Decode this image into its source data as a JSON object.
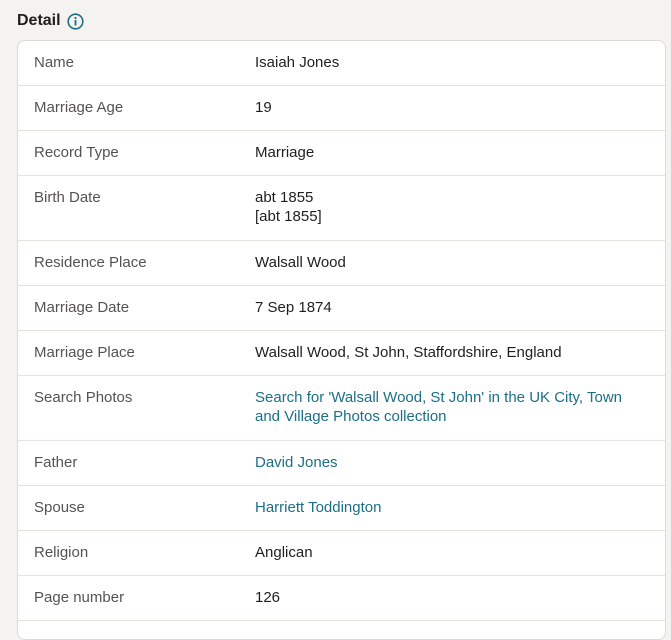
{
  "header": {
    "title": "Detail",
    "info_icon": "info-circle-icon",
    "accent_color": "#1b6f86"
  },
  "rows": [
    {
      "label": "Name",
      "value": "Isaiah Jones"
    },
    {
      "label": "Marriage Age",
      "value": "19"
    },
    {
      "label": "Record Type",
      "value": "Marriage"
    },
    {
      "label": "Birth Date",
      "value_line1": "abt 1855",
      "value_line2": "[abt 1855]"
    },
    {
      "label": "Residence Place",
      "value": "Walsall Wood"
    },
    {
      "label": "Marriage Date",
      "value": "7 Sep 1874"
    },
    {
      "label": "Marriage Place",
      "value": "Walsall Wood, St John, Staffordshire, England"
    },
    {
      "label": "Search Photos",
      "link": "Search for 'Walsall Wood, St John' in the UK City, Town and Village Photos collection"
    },
    {
      "label": "Father",
      "link": "David Jones"
    },
    {
      "label": "Spouse",
      "link": "Harriett Toddington"
    },
    {
      "label": "Religion",
      "value": "Anglican"
    },
    {
      "label": "Page number",
      "value": "126"
    }
  ]
}
